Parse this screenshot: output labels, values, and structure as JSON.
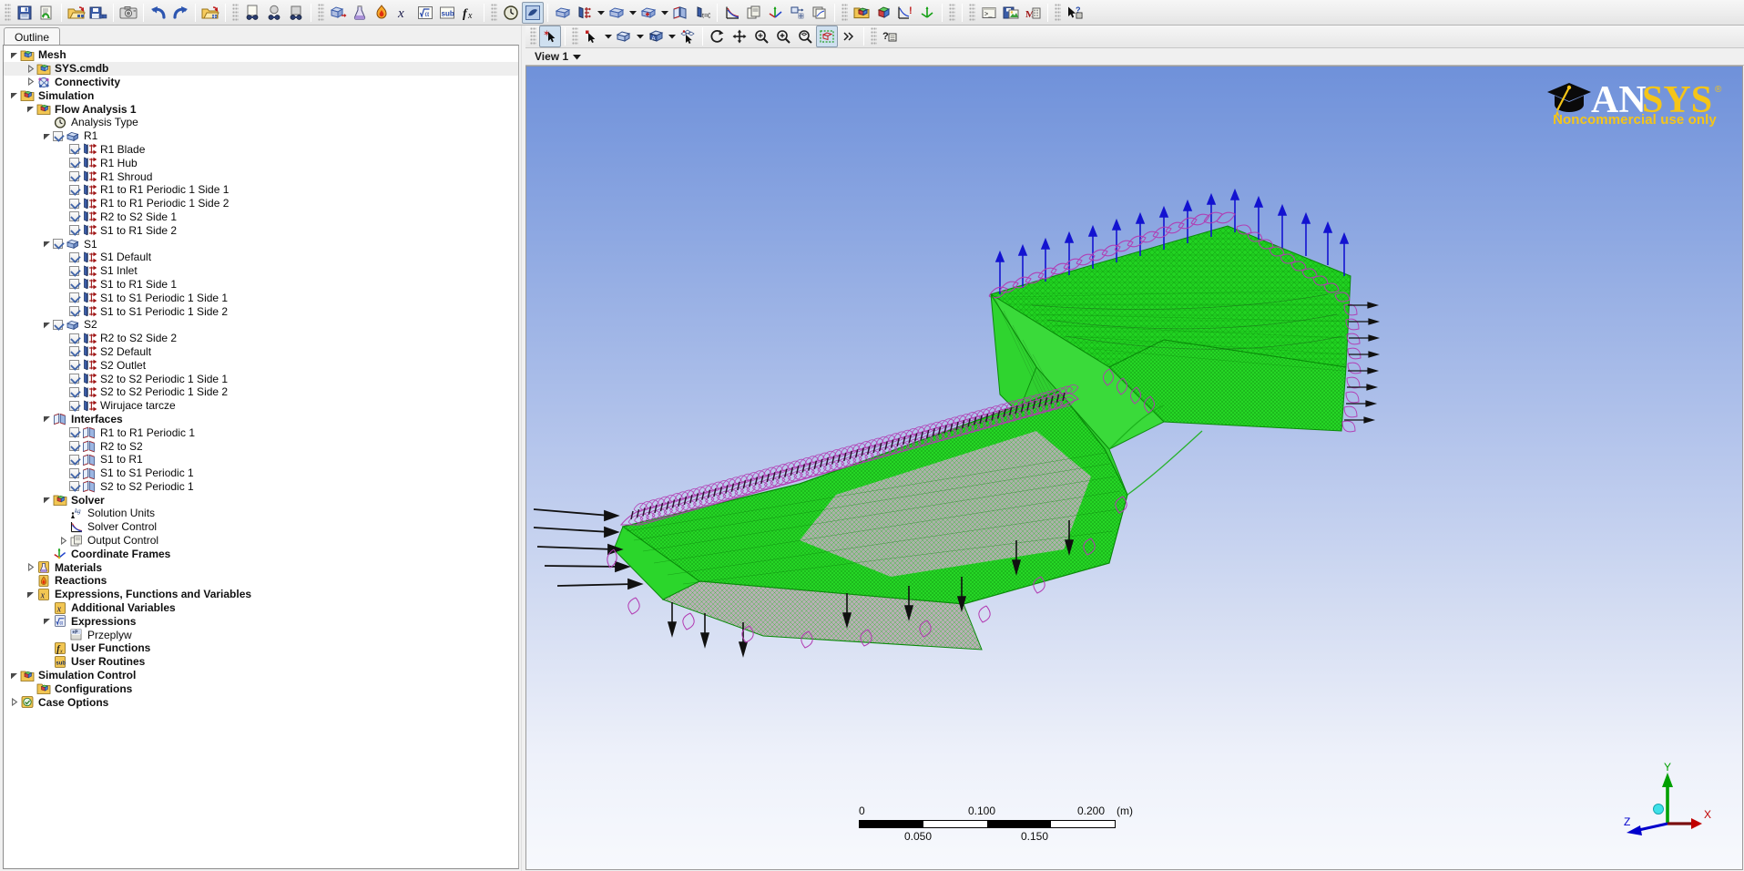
{
  "toolbar": {
    "groups": [
      {
        "name": "file",
        "buttons": [
          {
            "name": "save-case-button",
            "icon": "save-icon",
            "tooltip": "Save Case"
          },
          {
            "name": "refresh-button",
            "icon": "refresh-document-icon",
            "tooltip": "Refresh"
          }
        ]
      },
      {
        "name": "import-export",
        "buttons": [
          {
            "name": "import-mesh-button",
            "icon": "open-mesh-icon",
            "tooltip": "Import Mesh"
          },
          {
            "name": "export-mesh-button",
            "icon": "save-mesh-icon",
            "tooltip": "Export Mesh"
          }
        ]
      },
      {
        "name": "capture",
        "buttons": [
          {
            "name": "snapshot-button",
            "icon": "camera-icon",
            "tooltip": "Snapshot"
          }
        ]
      },
      {
        "name": "history",
        "buttons": [
          {
            "name": "undo-button",
            "icon": "undo-arrow-icon",
            "tooltip": "Undo"
          },
          {
            "name": "redo-button",
            "icon": "redo-arrow-icon",
            "tooltip": "Redo"
          }
        ]
      },
      {
        "name": "open",
        "buttons": [
          {
            "name": "open-definition-button",
            "icon": "open-folder-icon",
            "tooltip": "Open"
          }
        ]
      },
      {
        "name": "connectivity",
        "buttons": [
          {
            "name": "new-domain-button",
            "icon": "page-dumbbell-icon",
            "tooltip": "New Object"
          },
          {
            "name": "sphere-connector-button",
            "icon": "sphere-dumbbell-icon",
            "tooltip": "Connector"
          },
          {
            "name": "box-connector-button",
            "icon": "box-dumbbell-icon",
            "tooltip": "Connector Box"
          }
        ]
      },
      {
        "name": "physics",
        "buttons": [
          {
            "name": "domain-button",
            "icon": "domain-cube-icon",
            "tooltip": "Insert Domain"
          },
          {
            "name": "material-button",
            "icon": "flask-icon",
            "tooltip": "Insert Material"
          },
          {
            "name": "reaction-button",
            "icon": "flame-icon",
            "tooltip": "Insert Reaction"
          },
          {
            "name": "additional-variable-button",
            "icon": "x-variable-icon",
            "tooltip": "Additional Variable"
          },
          {
            "name": "expression-button",
            "icon": "sqrt-alpha-icon",
            "tooltip": "Insert Expression"
          },
          {
            "name": "user-routine-button",
            "icon": "sub-icon",
            "tooltip": "User Routine"
          },
          {
            "name": "user-function-button",
            "icon": "fx-icon",
            "tooltip": "User Function"
          }
        ]
      },
      {
        "name": "analysis",
        "buttons": [
          {
            "name": "analysis-type-button",
            "icon": "clock-icon",
            "tooltip": "Analysis Type"
          },
          {
            "name": "turbo-mode-button",
            "icon": "turbo-icon",
            "tooltip": "Turbo Mode",
            "pressed": true
          },
          {
            "name": "insert-domain-button",
            "icon": "domain-box-icon",
            "tooltip": "Insert Domain"
          },
          {
            "name": "boundary-button",
            "icon": "boundary-icon",
            "tooltip": "Insert Boundary",
            "dropdown": true
          },
          {
            "name": "subdomain-button",
            "icon": "subdomain-icon",
            "tooltip": "Insert Subdomain",
            "dropdown": true
          },
          {
            "name": "source-point-button",
            "icon": "domain-plus-icon",
            "tooltip": "Source Point",
            "dropdown": true
          },
          {
            "name": "interface-button",
            "icon": "interface-icon",
            "tooltip": "Insert Domain Interface"
          },
          {
            "name": "initialization-button",
            "icon": "initial-t0-icon",
            "tooltip": "Global Initialization"
          }
        ]
      },
      {
        "name": "solver-ctl",
        "buttons": [
          {
            "name": "solver-control-button",
            "icon": "solver-chart-icon",
            "tooltip": "Solver Control"
          },
          {
            "name": "output-control-button",
            "icon": "output-control-icon",
            "tooltip": "Output Control"
          },
          {
            "name": "coordinate-frame-button",
            "icon": "coordinate-frame-icon",
            "tooltip": "Coordinate Frame"
          },
          {
            "name": "mesh-adaption-button",
            "icon": "mesh-adaption-icon",
            "tooltip": "Mesh Adaption"
          },
          {
            "name": "configuration-button",
            "icon": "configuration-icon",
            "tooltip": "Configuration"
          }
        ]
      },
      {
        "name": "case",
        "buttons": [
          {
            "name": "case-options-button",
            "icon": "case-folder-icon",
            "tooltip": "Case Options"
          },
          {
            "name": "simulation-button",
            "icon": "simulation-cube-icon",
            "tooltip": "Simulation"
          },
          {
            "name": "define-run-button",
            "icon": "define-run-icon",
            "tooltip": "Define Run"
          },
          {
            "name": "write-solver-file-button",
            "icon": "mesh-adapt-green-icon",
            "tooltip": "Write Solver File"
          }
        ]
      },
      {
        "name": "tools",
        "buttons": [
          {
            "name": "command-editor-button",
            "icon": "command-prompt-icon",
            "tooltip": "Command Editor"
          },
          {
            "name": "save-picture-button",
            "icon": "save-picture-icon",
            "tooltip": "Save Picture"
          },
          {
            "name": "report-button",
            "icon": "report-icon",
            "tooltip": "Report"
          }
        ]
      },
      {
        "name": "help",
        "buttons": [
          {
            "name": "whats-this-help-button",
            "icon": "pointer-question-icon",
            "tooltip": "What's This?"
          }
        ]
      }
    ]
  },
  "left_panel": {
    "tab_label": "Outline",
    "tree": [
      {
        "label": "Mesh",
        "depth": 0,
        "bold": true,
        "icon": "mesh-folder-icon",
        "expander": "expanded"
      },
      {
        "label": "SYS.cmdb",
        "depth": 1,
        "bold": true,
        "icon": "mesh-folder-icon",
        "expander": "collapsed",
        "selected": true
      },
      {
        "label": "Connectivity",
        "depth": 1,
        "bold": true,
        "icon": "connectivity-icon",
        "expander": "collapsed"
      },
      {
        "label": "Simulation",
        "depth": 0,
        "bold": true,
        "icon": "simulation-folder-icon",
        "expander": "expanded"
      },
      {
        "label": "Flow Analysis 1",
        "depth": 1,
        "bold": true,
        "icon": "simulation-folder-icon",
        "expander": "expanded"
      },
      {
        "label": "Analysis Type",
        "depth": 2,
        "icon": "clock-icon"
      },
      {
        "label": "R1",
        "depth": 2,
        "icon": "domain-icon",
        "expander": "expanded",
        "checkbox": true
      },
      {
        "label": "R1 Blade",
        "depth": 3,
        "icon": "boundary-icon",
        "checkbox": true
      },
      {
        "label": "R1 Hub",
        "depth": 3,
        "icon": "boundary-icon",
        "checkbox": true
      },
      {
        "label": "R1 Shroud",
        "depth": 3,
        "icon": "boundary-icon",
        "checkbox": true
      },
      {
        "label": "R1 to R1 Periodic 1 Side 1",
        "depth": 3,
        "icon": "boundary-icon",
        "checkbox": true
      },
      {
        "label": "R1 to R1 Periodic 1 Side 2",
        "depth": 3,
        "icon": "boundary-icon",
        "checkbox": true
      },
      {
        "label": "R2 to S2 Side 1",
        "depth": 3,
        "icon": "boundary-icon",
        "checkbox": true
      },
      {
        "label": "S1 to R1 Side 2",
        "depth": 3,
        "icon": "boundary-icon",
        "checkbox": true
      },
      {
        "label": "S1",
        "depth": 2,
        "icon": "domain-icon",
        "expander": "expanded",
        "checkbox": true
      },
      {
        "label": "S1 Default",
        "depth": 3,
        "icon": "boundary-icon",
        "checkbox": true
      },
      {
        "label": "S1 Inlet",
        "depth": 3,
        "icon": "boundary-icon",
        "checkbox": true
      },
      {
        "label": "S1 to R1 Side 1",
        "depth": 3,
        "icon": "boundary-icon",
        "checkbox": true
      },
      {
        "label": "S1 to S1 Periodic 1 Side 1",
        "depth": 3,
        "icon": "boundary-icon",
        "checkbox": true
      },
      {
        "label": "S1 to S1 Periodic 1 Side 2",
        "depth": 3,
        "icon": "boundary-icon",
        "checkbox": true
      },
      {
        "label": "S2",
        "depth": 2,
        "icon": "domain-icon",
        "expander": "expanded",
        "checkbox": true
      },
      {
        "label": "R2 to S2 Side 2",
        "depth": 3,
        "icon": "boundary-icon",
        "checkbox": true
      },
      {
        "label": "S2 Default",
        "depth": 3,
        "icon": "boundary-icon",
        "checkbox": true
      },
      {
        "label": "S2 Outlet",
        "depth": 3,
        "icon": "boundary-icon",
        "checkbox": true
      },
      {
        "label": "S2 to S2 Periodic 1 Side 1",
        "depth": 3,
        "icon": "boundary-icon",
        "checkbox": true
      },
      {
        "label": "S2 to S2 Periodic 1 Side 2",
        "depth": 3,
        "icon": "boundary-icon",
        "checkbox": true
      },
      {
        "label": "Wirujace tarcze",
        "depth": 3,
        "icon": "boundary-icon",
        "checkbox": true
      },
      {
        "label": "Interfaces",
        "depth": 2,
        "bold": true,
        "icon": "interface-icon",
        "expander": "expanded"
      },
      {
        "label": "R1 to R1 Periodic 1",
        "depth": 3,
        "icon": "interface-icon",
        "checkbox": true
      },
      {
        "label": "R2 to S2",
        "depth": 3,
        "icon": "interface-icon",
        "checkbox": true
      },
      {
        "label": "S1 to R1",
        "depth": 3,
        "icon": "interface-icon",
        "checkbox": true
      },
      {
        "label": "S1 to S1 Periodic 1",
        "depth": 3,
        "icon": "interface-icon",
        "checkbox": true
      },
      {
        "label": "S2 to S2 Periodic 1",
        "depth": 3,
        "icon": "interface-icon",
        "checkbox": true
      },
      {
        "label": "Solver",
        "depth": 2,
        "bold": true,
        "icon": "solver-folder-icon",
        "expander": "expanded"
      },
      {
        "label": "Solution Units",
        "depth": 3,
        "icon": "solution-units-icon"
      },
      {
        "label": "Solver Control",
        "depth": 3,
        "icon": "solver-chart-icon"
      },
      {
        "label": "Output Control",
        "depth": 3,
        "icon": "output-control-icon",
        "expander": "collapsed"
      },
      {
        "label": "Coordinate Frames",
        "depth": 2,
        "bold": true,
        "icon": "coordinate-frame-icon"
      },
      {
        "label": "Materials",
        "depth": 1,
        "bold": true,
        "icon": "flask-icon",
        "expander": "collapsed"
      },
      {
        "label": "Reactions",
        "depth": 1,
        "bold": true,
        "icon": "flame-icon"
      },
      {
        "label": "Expressions, Functions and Variables",
        "depth": 1,
        "bold": true,
        "icon": "x-variable-icon",
        "expander": "expanded"
      },
      {
        "label": "Additional Variables",
        "depth": 2,
        "bold": true,
        "icon": "x-variable-icon"
      },
      {
        "label": "Expressions",
        "depth": 2,
        "bold": true,
        "icon": "expressions-icon",
        "expander": "expanded"
      },
      {
        "label": "Przeplyw",
        "depth": 3,
        "icon": "expression-item-icon"
      },
      {
        "label": "User Functions",
        "depth": 2,
        "bold": true,
        "icon": "fx-icon"
      },
      {
        "label": "User Routines",
        "depth": 2,
        "bold": true,
        "icon": "sub-icon"
      },
      {
        "label": "Simulation Control",
        "depth": 0,
        "bold": true,
        "icon": "simulation-folder-icon",
        "expander": "expanded"
      },
      {
        "label": "Configurations",
        "depth": 1,
        "bold": true,
        "icon": "configuration-icon"
      },
      {
        "label": "Case Options",
        "depth": 0,
        "bold": true,
        "icon": "case-options-icon",
        "expander": "collapsed"
      }
    ]
  },
  "viewer": {
    "toolbar": [
      {
        "name": "select-mode-button",
        "icon": "select-arrow-star-icon",
        "pressed": true
      },
      {
        "name": "pick-mode-button",
        "icon": "pick-arrow-icon",
        "dropdown": true
      },
      {
        "name": "single-select-button",
        "icon": "box-select-icon",
        "dropdown": true
      },
      {
        "name": "render-mode-button",
        "icon": "cube-render-icon",
        "dropdown": true
      },
      {
        "name": "probe-button",
        "icon": "probe-arrow-icon"
      },
      {
        "name": "rotate-button",
        "icon": "rotate-icon"
      },
      {
        "name": "pan-button",
        "icon": "pan-icon"
      },
      {
        "name": "zoom-box-button",
        "icon": "zoom-box-icon"
      },
      {
        "name": "zoom-in-button",
        "icon": "zoom-in-icon"
      },
      {
        "name": "fit-view-button",
        "icon": "fit-view-icon"
      },
      {
        "name": "predefined-view-button",
        "icon": "predefined-view-icon",
        "pressed": true
      },
      {
        "name": "toolbar-overflow-button",
        "icon": "chevron-double-right-icon"
      },
      {
        "name": "viewer-help-button",
        "icon": "question-panel-icon"
      }
    ],
    "view_tab_label": "View 1",
    "logo_text": "ANSYS",
    "logo_registered": "®",
    "logo_subtitle": "Noncommercial use only",
    "colors": {
      "logo_yellow": "#f5c518",
      "logo_white": "#ffffff",
      "background_top": "#6f91da",
      "background_bottom": "#f7f9fd",
      "mesh_green": "#1fd41f",
      "mesh_magenta": "#b23ab2",
      "vector_blue": "#1313d0"
    },
    "scalebar": {
      "unit": "(m)",
      "top_labels": [
        "0",
        "0.100",
        "0.200"
      ],
      "bottom_labels": [
        "0.050",
        "0.150"
      ],
      "segments": [
        "dark",
        "light",
        "dark",
        "light"
      ]
    },
    "triad": {
      "x_label": "X",
      "y_label": "Y",
      "z_label": "Z",
      "x_color": "#c00000",
      "y_color": "#00a000",
      "z_color": "#0000cc"
    }
  }
}
